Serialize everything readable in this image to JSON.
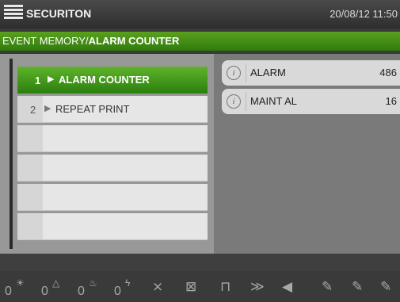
{
  "header": {
    "brand": "SECURITON",
    "datetime": "20/08/12 11:50"
  },
  "breadcrumb": {
    "path": "EVENT MEMORY/",
    "current": "ALARM COUNTER"
  },
  "menu": {
    "items": [
      {
        "num": "1",
        "label": "ALARM COUNTER",
        "selected": true
      },
      {
        "num": "2",
        "label": "REPEAT PRINT",
        "selected": false
      }
    ]
  },
  "counters": [
    {
      "label": "ALARM",
      "value": "486"
    },
    {
      "label": "MAINT AL",
      "value": "16"
    }
  ],
  "toolbar": {
    "counts": [
      "0",
      "0",
      "0",
      "0"
    ],
    "icons": [
      "sun-alarm-icon",
      "warning-triangle-icon",
      "fire-icon",
      "fault-icon",
      "disabled-detector-icon",
      "disabled-output-icon",
      "sounder-icon",
      "mute-icon",
      "speaker-icon",
      "edit1-icon",
      "edit2-icon",
      "edit3-icon"
    ]
  },
  "colors": {
    "accent_green": "#3a8f15",
    "header_bg": "#3a3a3a"
  }
}
